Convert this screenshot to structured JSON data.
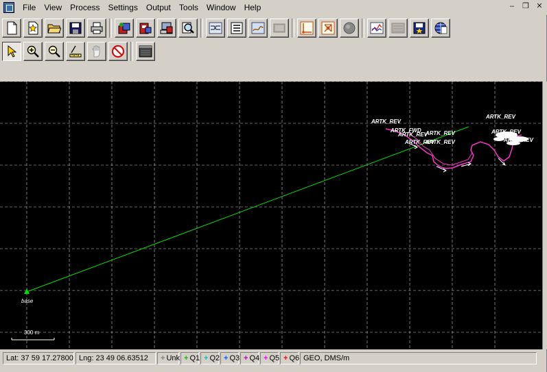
{
  "menu": {
    "items": [
      "File",
      "View",
      "Process",
      "Settings",
      "Output",
      "Tools",
      "Window",
      "Help"
    ]
  },
  "window_controls": {
    "minimize": "–",
    "restore": "❐",
    "close": "✕"
  },
  "toolbar1": {
    "buttons": [
      {
        "name": "new-document-icon"
      },
      {
        "name": "open-project-icon"
      },
      {
        "name": "open-folder-icon"
      },
      {
        "name": "save-icon"
      },
      {
        "name": "print-icon"
      },
      {
        "name": "import-data-icon"
      },
      {
        "name": "import-data2-icon"
      },
      {
        "name": "computer-icon"
      },
      {
        "name": "search-document-icon"
      },
      {
        "name": "process-icon"
      },
      {
        "name": "list-icon"
      },
      {
        "name": "map-process-icon"
      },
      {
        "name": "disabled-tool-icon"
      },
      {
        "name": "axes-icon"
      },
      {
        "name": "network-icon"
      },
      {
        "name": "sphere-icon"
      },
      {
        "name": "graph-icon"
      },
      {
        "name": "disabled-grid-icon"
      },
      {
        "name": "save-output-icon"
      },
      {
        "name": "globe-grid-icon"
      }
    ]
  },
  "toolbar2": {
    "buttons": [
      {
        "name": "select-pointer-icon",
        "pressed": true
      },
      {
        "name": "zoom-in-icon"
      },
      {
        "name": "zoom-out-icon"
      },
      {
        "name": "measure-ruler-icon"
      },
      {
        "name": "pan-hand-icon"
      },
      {
        "name": "no-entry-icon"
      },
      {
        "name": "window-icon"
      }
    ]
  },
  "map": {
    "background": "#000000",
    "grid_color": "#c8c8c8",
    "baseline_color": "#00e000",
    "track_color": "#ff33cc",
    "base_label": "base",
    "scale_label": "300 m",
    "labels": [
      "ARTK_REV",
      "ARTK_FWD",
      "ARTK_REV",
      "ARTK_REV",
      "ARTK_REV",
      "ARTK_REV",
      "ARTK_REV",
      "ARTK_REV",
      "ARTK_REV"
    ]
  },
  "status": {
    "lat": "Lat: 37 59 17.27800",
    "lng": "Lng: 23 49 06.63512",
    "unk": "Unk",
    "q1": "Q1",
    "q2": "Q2",
    "q3": "Q3",
    "q4": "Q4",
    "q5": "Q5",
    "q6": "Q6",
    "coord_mode": "GEO, DMS/m",
    "colors": {
      "unk": "#808080",
      "q1": "#00c000",
      "q2": "#00c0c0",
      "q3": "#0060ff",
      "q4": "#c000c0",
      "q5": "#ff00ff",
      "q6": "#ff0000"
    }
  }
}
